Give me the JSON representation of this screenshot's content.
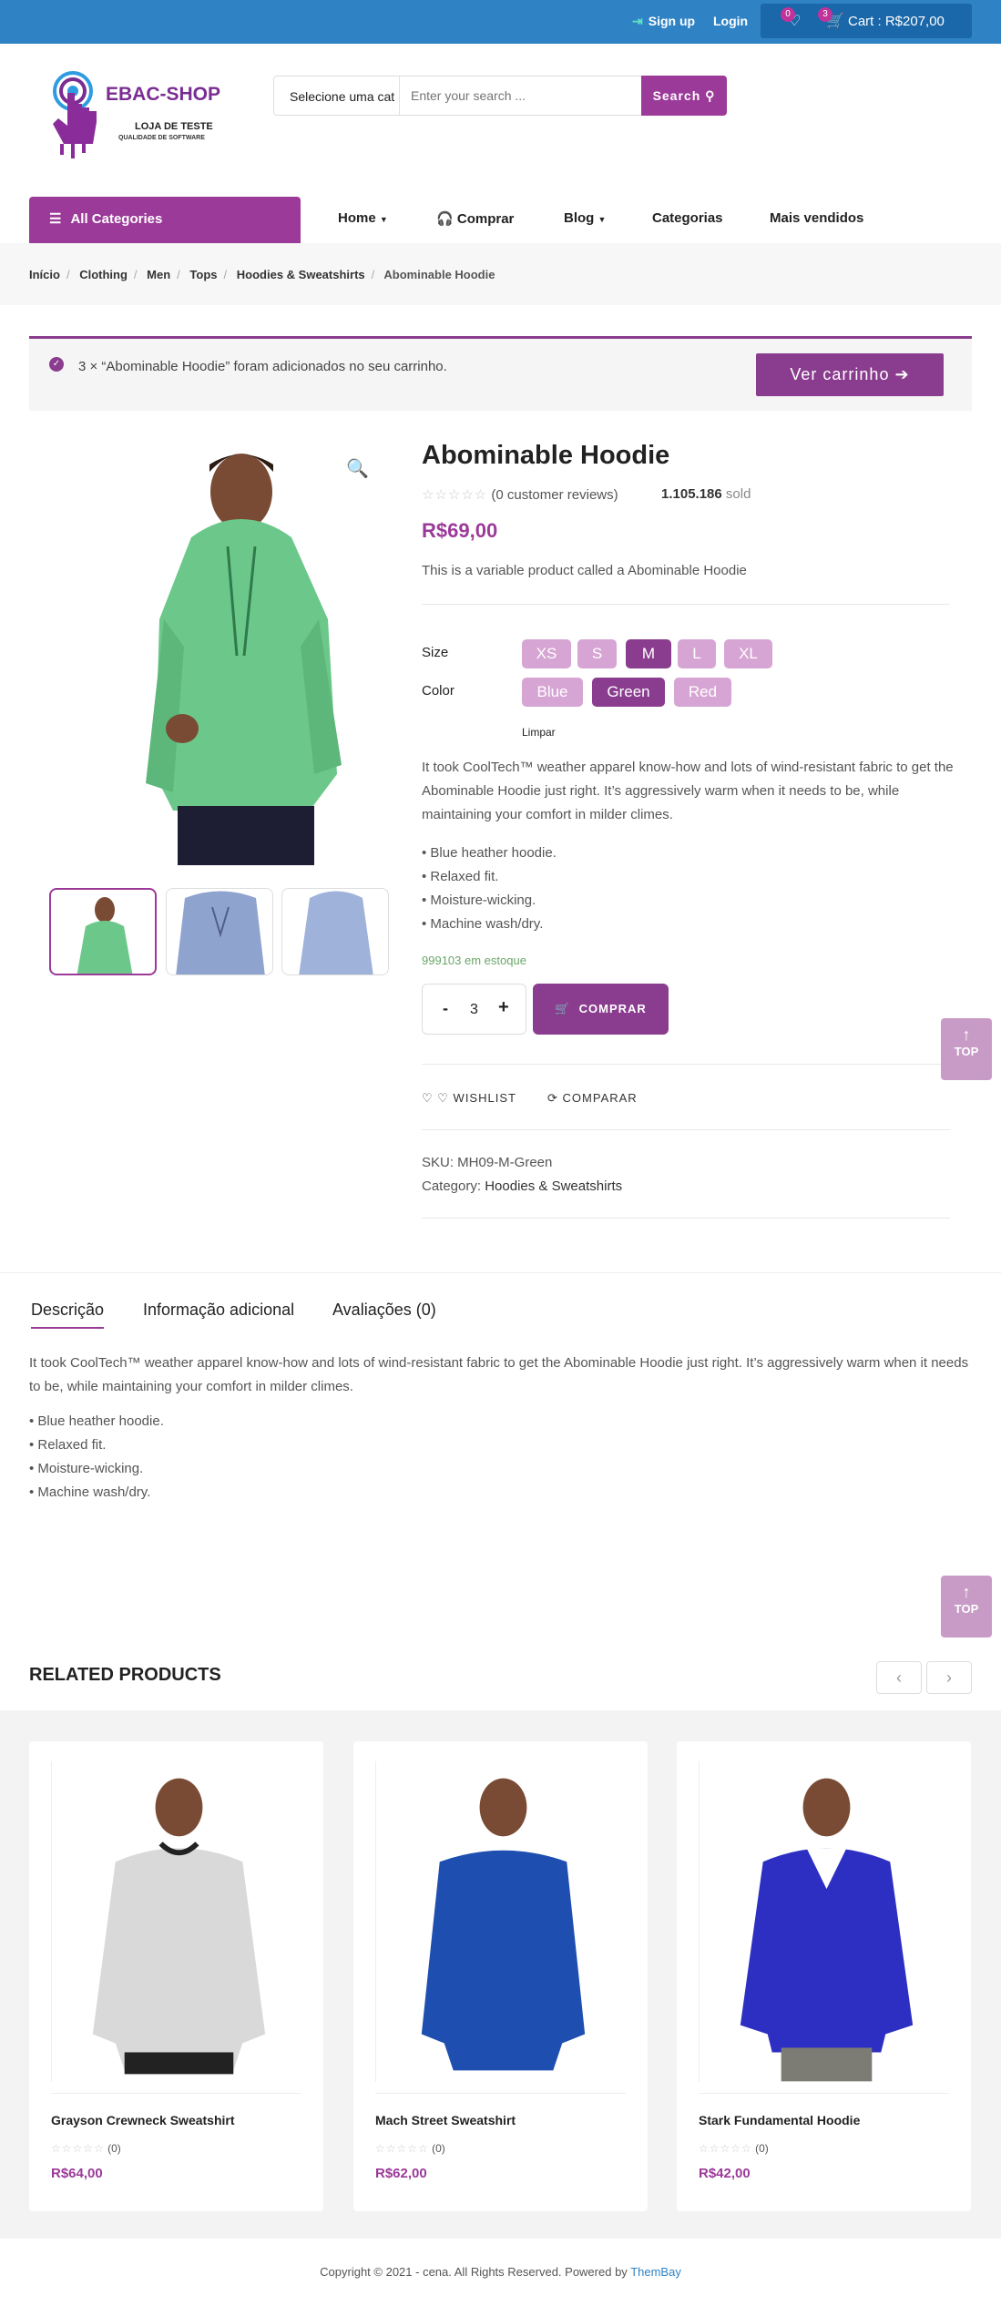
{
  "topbar": {
    "signup": "Sign up",
    "login": "Login",
    "wishlist_count": "0",
    "cart_count": "3",
    "cart_label": "Cart : R$207,00"
  },
  "logo": {
    "title": "EBAC-SHOP",
    "subtitle": "LOJA DE TESTE",
    "tagline": "QUALIDADE DE SOFTWARE"
  },
  "search": {
    "category": "Selecione uma cat",
    "placeholder": "Enter your search ...",
    "button": "Search"
  },
  "nav": {
    "all_categories": "All Categories",
    "items": [
      "Home",
      "Comprar",
      "Blog",
      "Categorias",
      "Mais vendidos"
    ]
  },
  "breadcrumb": [
    "Início",
    "Clothing",
    "Men",
    "Tops",
    "Hoodies & Sweatshirts",
    "Abominable Hoodie"
  ],
  "notice": {
    "message": "3 × “Abominable Hoodie” foram adicionados no seu carrinho.",
    "button": "Ver carrinho"
  },
  "product": {
    "title": "Abominable Hoodie",
    "reviews": "(0 customer reviews)",
    "sold_count": "1.105.186",
    "sold_label": "sold",
    "price": "R$69,00",
    "short_description": "This is a variable product called a Abominable Hoodie",
    "size_label": "Size",
    "sizes": [
      "XS",
      "S",
      "M",
      "L",
      "XL"
    ],
    "selected_size": "M",
    "color_label": "Color",
    "colors": [
      "Blue",
      "Green",
      "Red"
    ],
    "selected_color": "Green",
    "clear": "Limpar",
    "description": "It took CoolTech™ weather apparel know-how and lots of wind-resistant fabric to get the Abominable Hoodie just right. It’s aggressively warm when it needs to be, while maintaining your comfort in milder climes.",
    "bullets": [
      "• Blue heather hoodie.",
      "• Relaxed fit.",
      "• Moisture-wicking.",
      "• Machine wash/dry."
    ],
    "stock": "999103 em estoque",
    "quantity": "3",
    "buy": "COMPRAR",
    "wishlist": "WISHLIST",
    "compare": "COMPARAR",
    "sku": "SKU: MH09-M-Green",
    "category_label": "Category:",
    "category": "Hoodies & Sweatshirts"
  },
  "tabs": {
    "items": [
      "Descrição",
      "Informação adicional",
      "Avaliações (0)"
    ],
    "description": "It took CoolTech™ weather apparel know-how and lots of wind-resistant fabric to get the Abominable Hoodie just right. It’s aggressively warm when it needs to be, while maintaining your comfort in milder climes.",
    "bullets": [
      "• Blue heather hoodie.",
      "• Relaxed fit.",
      "• Moisture-wicking.",
      "• Machine wash/dry."
    ]
  },
  "top_button": "TOP",
  "related": {
    "title": "RELATED PRODUCTS",
    "products": [
      {
        "name": "Grayson Crewneck Sweatshirt",
        "rating": "(0)",
        "price": "R$64,00"
      },
      {
        "name": "Mach Street Sweatshirt",
        "rating": "(0)",
        "price": "R$62,00"
      },
      {
        "name": "Stark Fundamental Hoodie",
        "rating": "(0)",
        "price": "R$42,00"
      }
    ]
  },
  "footer": {
    "copyright": "Copyright © 2021 - cena. All Rights Reserved. Powered by",
    "powered_by": "ThemBay"
  },
  "colors": {
    "topbar": "#2f83c5",
    "brand": "#9b3a99",
    "accent_dark": "#8a3d8e"
  }
}
